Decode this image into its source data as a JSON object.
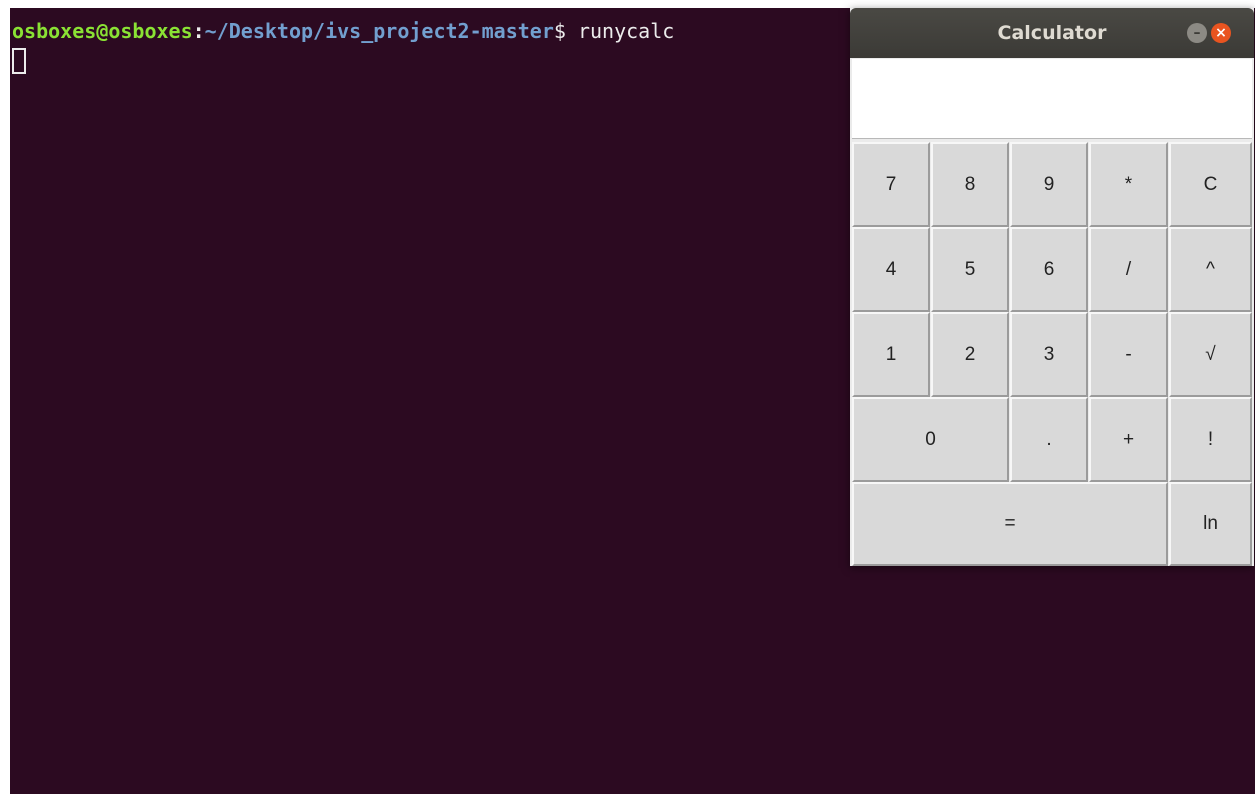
{
  "terminal": {
    "prompt_user": "osboxes@osboxes",
    "prompt_colon": ":",
    "prompt_path": "~/Desktop/ivs_project2-master",
    "prompt_dollar": "$",
    "command": " runycalc",
    "colors": {
      "background": "#2c0a21",
      "user": "#8ae234",
      "path": "#729fcf",
      "text": "#ececec"
    }
  },
  "calculator": {
    "title": "Calculator",
    "display_value": "",
    "minimize_icon": "minimize-icon",
    "close_icon": "close-icon",
    "close_glyph": "×",
    "minimize_glyph": "–",
    "keys": {
      "k7": "7",
      "k8": "8",
      "k9": "9",
      "kmul": "*",
      "kclear": "C",
      "k4": "4",
      "k5": "5",
      "k6": "6",
      "kdiv": "/",
      "kpow": "^",
      "k1": "1",
      "k2": "2",
      "k3": "3",
      "kminus": "-",
      "ksqrt": "√",
      "k0": "0",
      "kdot": ".",
      "kplus": "+",
      "kfact": "!",
      "keq": "=",
      "kln": "ln"
    },
    "colors": {
      "titlebar": "#3b3a36",
      "close": "#e95420",
      "key_face": "#d9d9d9"
    }
  }
}
